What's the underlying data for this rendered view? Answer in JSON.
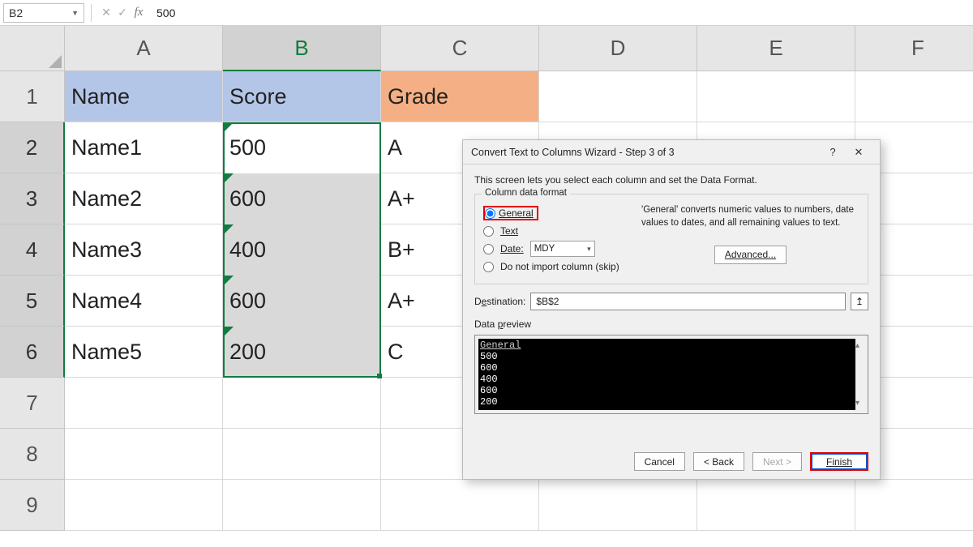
{
  "formula_bar": {
    "cell_ref": "B2",
    "value": "500",
    "fx_label": "fx"
  },
  "columns": [
    "A",
    "B",
    "C",
    "D",
    "E",
    "F"
  ],
  "rows": [
    "1",
    "2",
    "3",
    "4",
    "5",
    "6",
    "7",
    "8",
    "9"
  ],
  "headers": {
    "name": "Name",
    "score": "Score",
    "grade": "Grade"
  },
  "data_rows": [
    {
      "name": "Name1",
      "score": "500",
      "grade": "A"
    },
    {
      "name": "Name2",
      "score": "600",
      "grade": "A+"
    },
    {
      "name": "Name3",
      "score": "400",
      "grade": "B+"
    },
    {
      "name": "Name4",
      "score": "600",
      "grade": "A+"
    },
    {
      "name": "Name5",
      "score": "200",
      "grade": "C"
    }
  ],
  "dialog": {
    "title": "Convert Text to Columns Wizard - Step 3 of 3",
    "help_label": "?",
    "close_label": "✕",
    "description": "This screen lets you select each column and set the Data Format.",
    "group_label": "Column data format",
    "radio_general": "General",
    "radio_text": "Text",
    "radio_date": "Date:",
    "date_option": "MDY",
    "radio_skip": "Do not import column (skip)",
    "general_hint": "'General' converts numeric values to numbers, date values to dates, and all remaining values to text.",
    "advanced": "Advanced...",
    "destination_label": "Destination:",
    "destination_value": "$B$2",
    "preview_label": "Data preview",
    "preview_header": "General",
    "preview_rows": [
      "500",
      "600",
      "400",
      "600",
      "200"
    ],
    "btn_cancel": "Cancel",
    "btn_back": "< Back",
    "btn_next": "Next >",
    "btn_finish": "Finish"
  }
}
